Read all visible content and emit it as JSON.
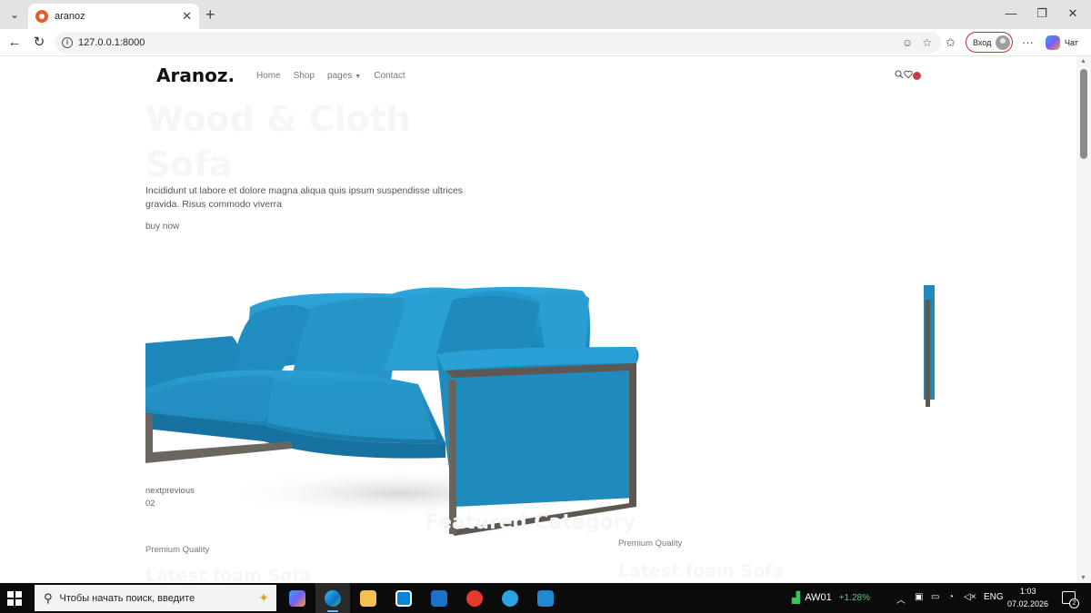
{
  "browser": {
    "tab_title": "aranoz",
    "url": "127.0.0.1:8000",
    "signin_label": "Вход",
    "copilot_label": "Чат"
  },
  "site": {
    "logo": "Aranoz.",
    "nav": [
      {
        "label": "Home"
      },
      {
        "label": "Shop"
      },
      {
        "label": "pages"
      },
      {
        "label": "Contact"
      }
    ],
    "hero": {
      "title": "Wood & Cloth Sofa",
      "description": "Incididunt ut labore et dolore magna aliqua quis ipsum suspendisse ultrices gravida. Risus commodo viverra",
      "cta": "buy now",
      "image_desc": "blue-fabric-sofa"
    },
    "slider": {
      "controls": "nextprevious",
      "counter": "02"
    },
    "featured_heading": "Featured Category",
    "categories": [
      {
        "tag": "Premium Quality",
        "title": "Latest foam Sofa"
      },
      {
        "tag": "Premium Quality",
        "title": "Latest foam Sofa"
      }
    ]
  },
  "taskbar": {
    "search_placeholder": "Чтобы начать поиск, введите",
    "stock_name": "AW01",
    "stock_delta": "+1.28%",
    "language": "ENG",
    "time": "1:03",
    "date": "07.02.2026",
    "notification_count": "2"
  },
  "colors": {
    "sofa_blue": "#1f8fc2",
    "accent_red": "#c0434a",
    "stock_green": "#4ccf6b"
  }
}
